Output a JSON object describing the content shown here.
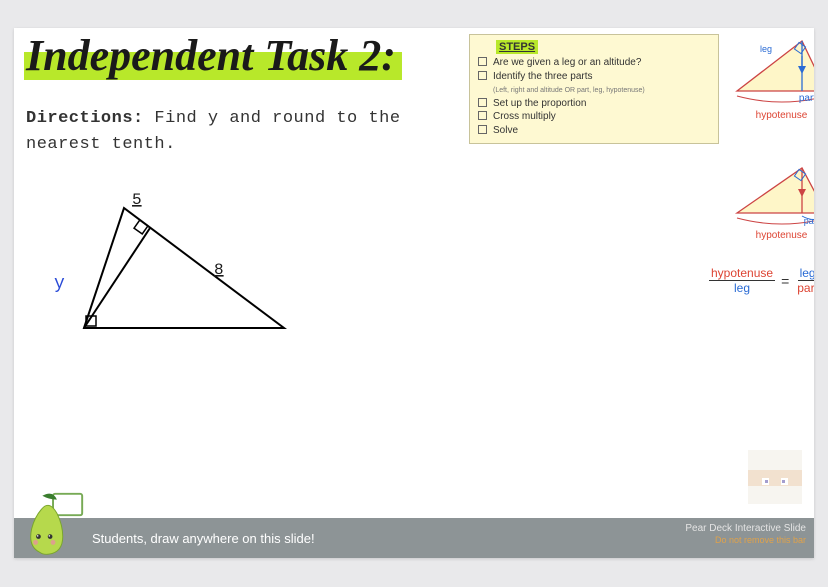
{
  "title": "Independent Task 2:",
  "directions_label": "Directions:",
  "directions_text": "Find y and round to the nearest tenth.",
  "steps": {
    "heading": "STEPS",
    "items": [
      {
        "text": "Are we given a leg or an altitude?"
      },
      {
        "text": "Identify the three parts",
        "sub": "(Left, right and altitude OR part, leg, hypotenuse)"
      },
      {
        "text": "Set up the proportion"
      },
      {
        "text": "Cross multiply"
      },
      {
        "text": "Solve"
      }
    ]
  },
  "problem": {
    "y_label": "y",
    "val_top": "5",
    "val_hyp": "8"
  },
  "reference": {
    "leg": "leg",
    "part": "part",
    "hypotenuse": "hypotenuse",
    "equation": {
      "lhs_top": "hypotenuse",
      "lhs_bot": "leg",
      "eq": "=",
      "rhs_top": "leg",
      "rhs_bot": "part"
    }
  },
  "footer": {
    "message": "Students, draw anywhere on this slide!",
    "brand": "Pear Deck Interactive Slide",
    "warn": "Do not remove this bar"
  }
}
